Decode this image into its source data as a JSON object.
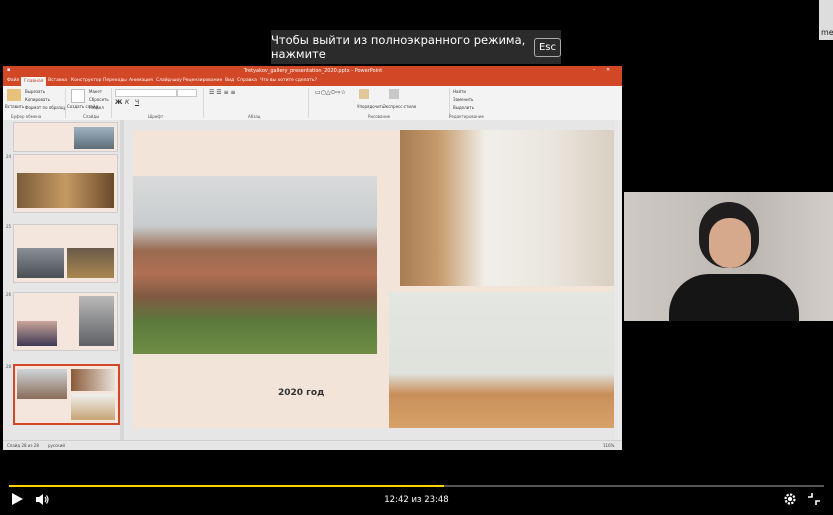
{
  "toast": {
    "text": "Чтобы выйти из полноэкранного режима, нажмите",
    "key": "Esc"
  },
  "corner": {
    "label": "me"
  },
  "ppt": {
    "title": "Tretyakov_gallery_presentation_2020.pptx - PowerPoint",
    "tabs": [
      "Файл",
      "Главная",
      "Вставка",
      "Конструктор",
      "Переходы",
      "Анимация",
      "Слайд-шоу",
      "Рецензирование",
      "Вид",
      "Справка",
      "Что вы хотите сделать?"
    ],
    "active_tab": "Главная",
    "ribbon_groups": [
      "Буфер обмена",
      "Слайды",
      "Шрифт",
      "Абзац",
      "Рисование",
      "Редактирование"
    ],
    "ribbon_buttons": {
      "paste": "Вставить",
      "cut": "Вырезать",
      "copy": "Копировать",
      "format": "Формат по образцу",
      "new_slide": "Создать слайд",
      "layout": "Макет",
      "reset": "Сбросить",
      "section": "Раздел",
      "arrange": "Упорядочить",
      "styles": "Экспресс-стили",
      "find": "Найти",
      "replace": "Заменить",
      "select": "Выделить"
    },
    "slide_numbers": [
      "24",
      "25",
      "26",
      "27",
      "28"
    ],
    "slide_year": "2020 год",
    "status_left": "Слайд 28 из 28",
    "status_lang": "русский",
    "zoom": "116%"
  },
  "player": {
    "time": "12:42 из 23:48",
    "progress": 0.534
  },
  "colors": {
    "accent": "#d24726",
    "progress": "#ffd400",
    "slide_bg": "#f3e4d9"
  }
}
